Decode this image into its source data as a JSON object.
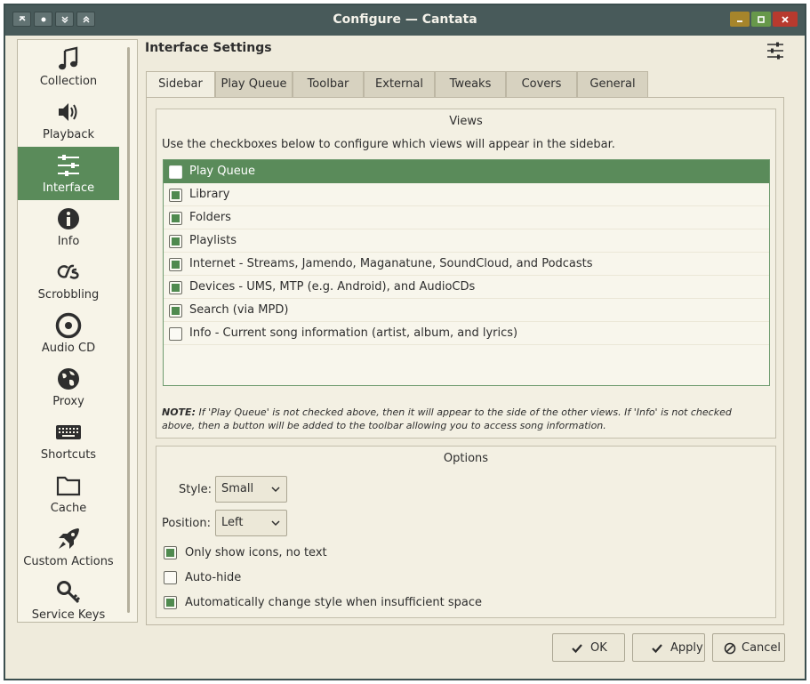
{
  "window": {
    "title": "Configure — Cantata"
  },
  "sidebar": {
    "items": [
      {
        "label": "Collection",
        "icon": "music-note-icon"
      },
      {
        "label": "Playback",
        "icon": "speaker-icon"
      },
      {
        "label": "Interface",
        "icon": "sliders-icon",
        "active": true
      },
      {
        "label": "Info",
        "icon": "info-icon"
      },
      {
        "label": "Scrobbling",
        "icon": "lastfm-icon"
      },
      {
        "label": "Audio CD",
        "icon": "cd-icon"
      },
      {
        "label": "Proxy",
        "icon": "globe-icon"
      },
      {
        "label": "Shortcuts",
        "icon": "keyboard-icon"
      },
      {
        "label": "Cache",
        "icon": "folder-icon"
      },
      {
        "label": "Custom Actions",
        "icon": "rocket-icon"
      },
      {
        "label": "Service Keys",
        "icon": "key-icon"
      }
    ]
  },
  "page": {
    "title": "Interface Settings"
  },
  "tabs": [
    {
      "label": "Sidebar",
      "active": true
    },
    {
      "label": "Play Queue"
    },
    {
      "label": "Toolbar"
    },
    {
      "label": "External"
    },
    {
      "label": "Tweaks"
    },
    {
      "label": "Covers"
    },
    {
      "label": "General"
    }
  ],
  "views": {
    "title": "Views",
    "hint": "Use the checkboxes below to configure which views will appear in the sidebar.",
    "items": [
      {
        "label": "Play Queue",
        "checked": false,
        "selected": true
      },
      {
        "label": "Library",
        "checked": true
      },
      {
        "label": "Folders",
        "checked": true
      },
      {
        "label": "Playlists",
        "checked": true
      },
      {
        "label": "Internet - Streams, Jamendo, Maganatune, SoundCloud, and Podcasts",
        "checked": true
      },
      {
        "label": "Devices - UMS, MTP (e.g. Android), and AudioCDs",
        "checked": true
      },
      {
        "label": "Search (via MPD)",
        "checked": true
      },
      {
        "label": "Info - Current song information (artist, album, and lyrics)",
        "checked": false
      }
    ],
    "note_label": "NOTE:",
    "note_text": "If 'Play Queue' is not checked above, then it will appear to the side of the other views. If 'Info' is not checked above, then a button will be added to the toolbar allowing you to access song information."
  },
  "options": {
    "title": "Options",
    "style_label": "Style:",
    "style_value": "Small",
    "position_label": "Position:",
    "position_value": "Left",
    "checks": [
      {
        "label": "Only show icons, no text",
        "checked": true
      },
      {
        "label": "Auto-hide",
        "checked": false
      },
      {
        "label": "Automatically change style when insufficient space",
        "checked": true
      }
    ]
  },
  "buttons": {
    "ok": "OK",
    "apply": "Apply",
    "cancel": "Cancel"
  },
  "colors": {
    "accent": "#5a8b5a",
    "titlebar": "#485a5a",
    "background": "#efebdc"
  }
}
